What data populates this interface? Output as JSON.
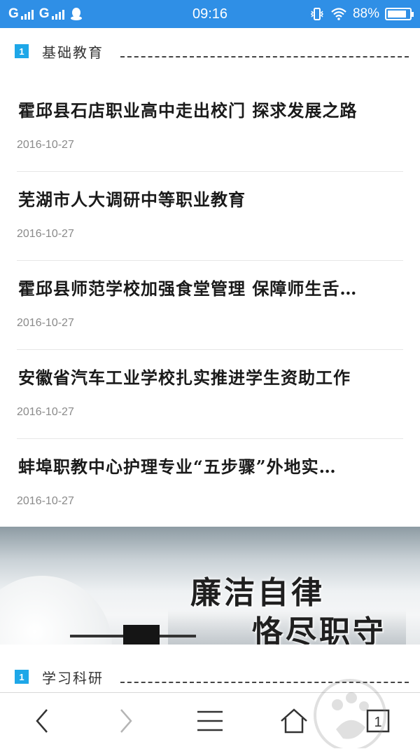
{
  "status_bar": {
    "carrier1": "G",
    "carrier2": "G",
    "time": "09:16",
    "battery_text": "88%",
    "battery_level": 0.88
  },
  "sections": [
    {
      "number": "1",
      "title": "基础教育"
    },
    {
      "number": "1",
      "title": "学习科研"
    }
  ],
  "news": [
    {
      "title": "霍邱县石店职业高中走出校门 探求发展之路",
      "date": "2016-10-27"
    },
    {
      "title": "芜湖市人大调研中等职业教育",
      "date": "2016-10-27"
    },
    {
      "title": "霍邱县师范学校加强食堂管理 保障师生舌…",
      "date": "2016-10-27"
    },
    {
      "title": "安徽省汽车工业学校扎实推进学生资助工作",
      "date": "2016-10-27"
    },
    {
      "title": "蚌埠职教中心护理专业“五步骤”外地实…",
      "date": "2016-10-27"
    }
  ],
  "banner": {
    "line1": "廉洁自律",
    "line2": "恪尽职守"
  },
  "toolbar": {
    "tab_count": "1",
    "icons": [
      "back-arrow-icon",
      "forward-arrow-icon",
      "menu-icon",
      "home-icon",
      "tabs-icon"
    ]
  },
  "colors": {
    "status_bar": "#2f8fe6",
    "section_badge": "#1ea7e8"
  }
}
